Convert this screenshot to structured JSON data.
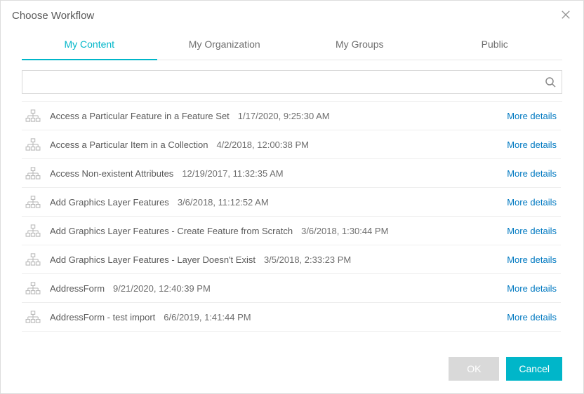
{
  "dialog": {
    "title": "Choose Workflow",
    "tabs": [
      {
        "label": "My Content",
        "active": true
      },
      {
        "label": "My Organization",
        "active": false
      },
      {
        "label": "My Groups",
        "active": false
      },
      {
        "label": "Public",
        "active": false
      }
    ],
    "search": {
      "value": "",
      "placeholder": ""
    },
    "more_details_label": "More details",
    "items": [
      {
        "name": "Access a Particular Feature in a Feature Set",
        "date": "1/17/2020, 9:25:30 AM"
      },
      {
        "name": "Access a Particular Item in a Collection",
        "date": "4/2/2018, 12:00:38 PM"
      },
      {
        "name": "Access Non-existent Attributes",
        "date": "12/19/2017, 11:32:35 AM"
      },
      {
        "name": "Add Graphics Layer Features",
        "date": "3/6/2018, 11:12:52 AM"
      },
      {
        "name": "Add Graphics Layer Features - Create Feature from Scratch",
        "date": "3/6/2018, 1:30:44 PM"
      },
      {
        "name": "Add Graphics Layer Features - Layer Doesn't Exist",
        "date": "3/5/2018, 2:33:23 PM"
      },
      {
        "name": "AddressForm",
        "date": "9/21/2020, 12:40:39 PM"
      },
      {
        "name": "AddressForm - test import",
        "date": "6/6/2019, 1:41:44 PM"
      }
    ],
    "ok_label": "OK",
    "cancel_label": "Cancel"
  },
  "icons": {
    "workflow": "workflow-icon",
    "search": "search-icon",
    "close": "close-icon"
  },
  "colors": {
    "accent": "#00b6c9",
    "link": "#0079c1"
  }
}
